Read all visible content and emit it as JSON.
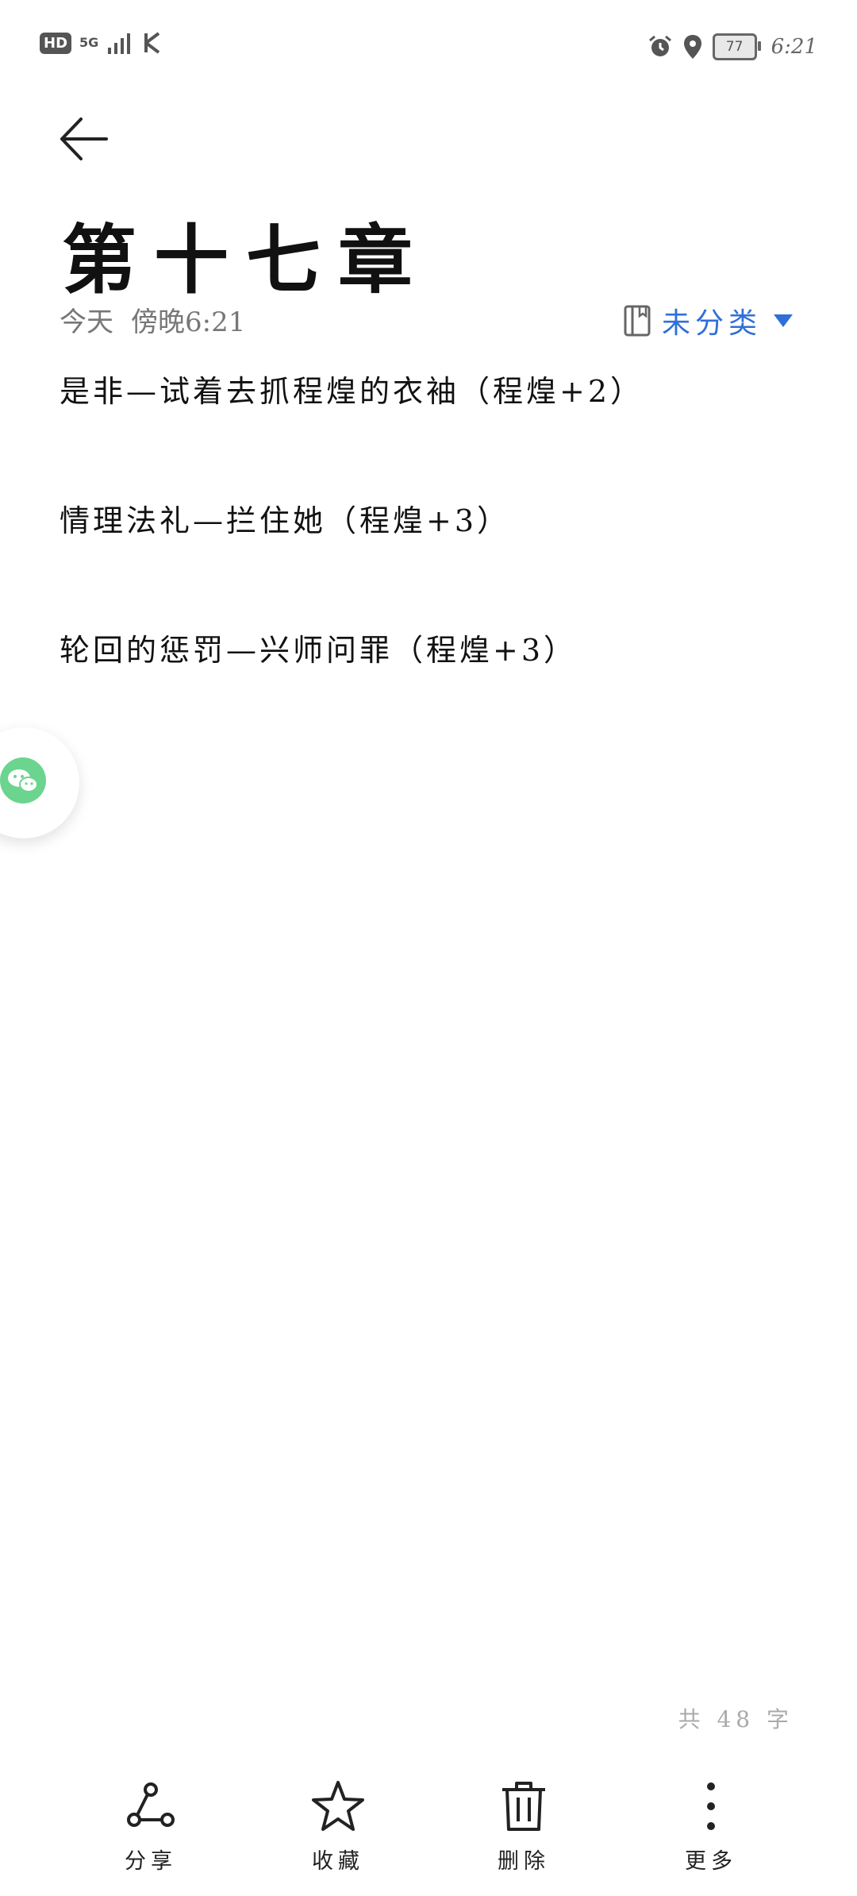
{
  "status_bar": {
    "hd": "HD",
    "network": "5G",
    "battery": "77",
    "time": "6:21"
  },
  "note": {
    "title": "第十七章",
    "date_day": "今天",
    "date_time": "傍晚6:21",
    "category": "未分类",
    "lines": [
      "是非—试着去抓程煌的衣袖（程煌+2）",
      "情理法礼—拦住她（程煌+3）",
      "轮回的惩罚—兴师问罪（程煌+3）"
    ],
    "word_count": "共 48 字"
  },
  "toolbar": {
    "share": "分享",
    "favorite": "收藏",
    "delete": "删除",
    "more": "更多"
  },
  "colors": {
    "accent": "#2f6fd7",
    "wechat": "#6bd48e"
  }
}
